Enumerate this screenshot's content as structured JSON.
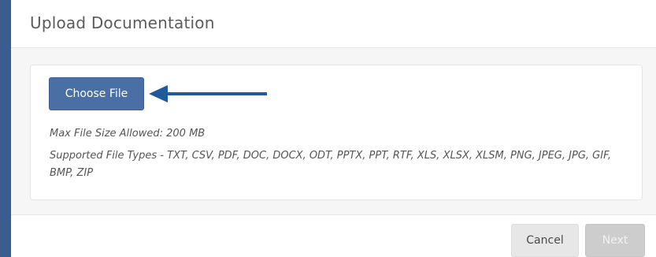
{
  "dialog": {
    "title": "Upload Documentation"
  },
  "upload": {
    "choose_file_label": "Choose File",
    "max_size_text": "Max File Size Allowed: 200 MB",
    "supported_types_text": "Supported File Types - TXT, CSV, PDF, DOC, DOCX, ODT, PPTX, PPT, RTF, XLS, XLSX, XLSM, PNG, JPEG, JPG, GIF, BMP, ZIP"
  },
  "footer": {
    "cancel_label": "Cancel",
    "next_label": "Next"
  },
  "colors": {
    "accent": "#4a6fa5",
    "arrow": "#1f5a9a",
    "frame": "#3a5c8f"
  },
  "icons": {
    "pointer": "arrow-left-icon"
  }
}
